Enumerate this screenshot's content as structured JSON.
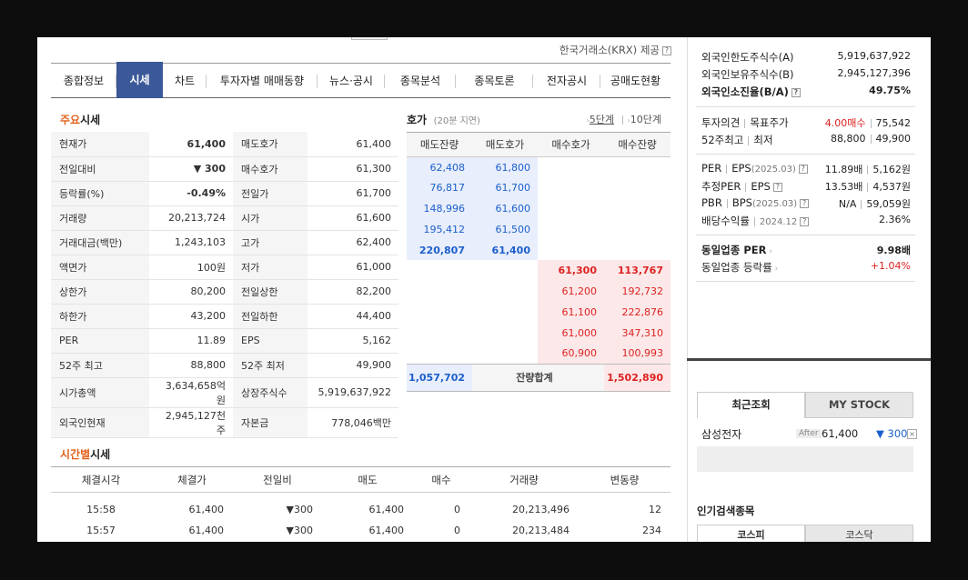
{
  "source_text": "한국거래소(KRX) 제공",
  "tabs": [
    {
      "label": "종합정보"
    },
    {
      "label": "시세"
    },
    {
      "label": "차트"
    },
    {
      "label": "투자자별 매매동향"
    },
    {
      "label": "뉴스·공시"
    },
    {
      "label": "종목분석"
    },
    {
      "label": "종목토론"
    },
    {
      "label": "전자공시"
    },
    {
      "label": "공매도현황"
    }
  ],
  "main_quote": {
    "title_hl": "주요",
    "title_rest": "시세",
    "rows": [
      {
        "k1": "현재가",
        "v1": "61,400",
        "k2": "매도호가",
        "v2": "61,400"
      },
      {
        "k1": "전일대비",
        "v1": "▼ 300",
        "k2": "매수호가",
        "v2": "61,300"
      },
      {
        "k1": "등락률(%)",
        "v1": "-0.49%",
        "k2": "전일가",
        "v2": "61,700"
      },
      {
        "k1": "거래량",
        "v1": "20,213,724",
        "k2": "시가",
        "v2": "61,600"
      },
      {
        "k1": "거래대금(백만)",
        "v1": "1,243,103",
        "k2": "고가",
        "v2": "62,400"
      },
      {
        "k1": "액면가",
        "v1": "100원",
        "k2": "저가",
        "v2": "61,000"
      },
      {
        "k1": "상한가",
        "v1": "80,200",
        "k2": "전일상한",
        "v2": "82,200"
      },
      {
        "k1": "하한가",
        "v1": "43,200",
        "k2": "전일하한",
        "v2": "44,400"
      },
      {
        "k1": "PER",
        "v1": "11.89",
        "k2": "EPS",
        "v2": "5,162"
      },
      {
        "k1": "52주 최고",
        "v1": "88,800",
        "k2": "52주 최저",
        "v2": "49,900"
      },
      {
        "k1": "시가총액",
        "v1": "3,634,658억원",
        "k2": "상장주식수",
        "v2": "5,919,637,922"
      },
      {
        "k1": "외국인현재",
        "v1": "2,945,127천주",
        "k2": "자본금",
        "v2": "778,046백만"
      }
    ]
  },
  "hoga": {
    "title": "호가",
    "delay": "(20분 지연)",
    "level5": "5단계",
    "level10": "10단계",
    "headers": [
      "매도잔량",
      "매도호가",
      "매수호가",
      "매수잔량"
    ],
    "asks": [
      {
        "qty": "62,408",
        "price": "61,800"
      },
      {
        "qty": "76,817",
        "price": "61,700"
      },
      {
        "qty": "148,996",
        "price": "61,600"
      },
      {
        "qty": "195,412",
        "price": "61,500"
      },
      {
        "qty": "220,807",
        "price": "61,400"
      }
    ],
    "bids": [
      {
        "price": "61,300",
        "qty": "113,767"
      },
      {
        "price": "61,200",
        "qty": "192,732"
      },
      {
        "price": "61,100",
        "qty": "222,876"
      },
      {
        "price": "61,000",
        "qty": "347,310"
      },
      {
        "price": "60,900",
        "qty": "100,993"
      }
    ],
    "total_ask": "1,057,702",
    "total_label": "잔량합계",
    "total_bid": "1,502,890"
  },
  "time_quote": {
    "title_hl": "시간별",
    "title_rest": "시세",
    "headers": [
      "체결시각",
      "체결가",
      "전일비",
      "매도",
      "매수",
      "거래량",
      "변동량"
    ],
    "rows": [
      {
        "time": "15:58",
        "price": "61,400",
        "change": "▼300",
        "sell": "61,400",
        "buy": "0",
        "volume": "20,213,496",
        "delta": "12"
      },
      {
        "time": "15:57",
        "price": "61,400",
        "change": "▼300",
        "sell": "61,400",
        "buy": "0",
        "volume": "20,213,484",
        "delta": "234"
      }
    ]
  },
  "right": {
    "foreign_limit_label": "외국인한도주식수(A)",
    "foreign_limit": "5,919,637,922",
    "foreign_hold_label": "외국인보유주식수(B)",
    "foreign_hold": "2,945,127,396",
    "foreign_ratio_label": "외국인소진율(B/A)",
    "foreign_ratio": "49.75%",
    "opinion_label": "투자의견",
    "target_label": "목표주가",
    "opinion": "4.00매수",
    "target": "75,542",
    "w52_label1": "52주최고",
    "w52_label2": "최저",
    "w52_high": "88,800",
    "w52_low": "49,900",
    "per_label": "PER",
    "eps_label": "EPS",
    "per_period": "(2025.03)",
    "per": "11.89배",
    "eps": "5,162원",
    "est_per_label": "추정PER",
    "est_eps_label": "EPS",
    "est_per": "13.53배",
    "est_eps": "4,537원",
    "pbr_label": "PBR",
    "bps_label": "BPS",
    "bps_period": "(2025.03)",
    "pbr": "N/A",
    "bps": "59,059원",
    "div_label": "배당수익률",
    "div_period": "2024.12",
    "div": "2.36%",
    "sector_per_label": "동일업종 PER",
    "sector_per": "9.98배",
    "sector_chg_label": "동일업종 등락률",
    "sector_chg": "+1.04%",
    "recent_tab": "최근조회",
    "mystock_tab": "MY STOCK",
    "recent_name": "삼성전자",
    "recent_after": "After",
    "recent_price": "61,400",
    "recent_change": "▼ 300",
    "popular_title": "인기검색종목",
    "kospi_tab": "코스피",
    "kosdaq_tab": "코스닥"
  }
}
